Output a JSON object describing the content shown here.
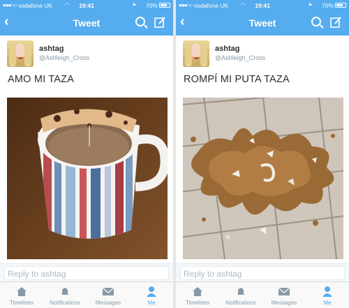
{
  "colors": {
    "accent": "#55acee",
    "text": "#292f33",
    "muted": "#8899a6"
  },
  "statusbar": {
    "signal": "●●●○○",
    "carrier": "vodafone UK",
    "wifi_icon": "wifi-icon",
    "time": "19:41",
    "arrow_icon": "location-arrow-icon",
    "battery": "70%"
  },
  "navbar": {
    "back_icon": "chevron-left-icon",
    "title": "Tweet",
    "search_icon": "search-icon",
    "compose_icon": "compose-icon"
  },
  "tweets": [
    {
      "username": "ashtag",
      "handle": "@Ashleigh_Cross",
      "text": "AMO MI TAZA",
      "photo": "striped-coffee-mug-photo"
    },
    {
      "username": "ashtag",
      "handle": "@Ashleigh_Cross",
      "text": "ROMPÍ MI PUTA TAZA",
      "photo": "spilled-coffee-on-tiles-photo"
    }
  ],
  "reply": {
    "placeholder": "Reply to ashtag"
  },
  "tabs": [
    {
      "label": "Timelines",
      "icon": "home-icon",
      "active": false
    },
    {
      "label": "Notifications",
      "icon": "bell-icon",
      "active": false
    },
    {
      "label": "Messages",
      "icon": "envelope-icon",
      "active": false
    },
    {
      "label": "Me",
      "icon": "person-icon",
      "active": true
    }
  ]
}
